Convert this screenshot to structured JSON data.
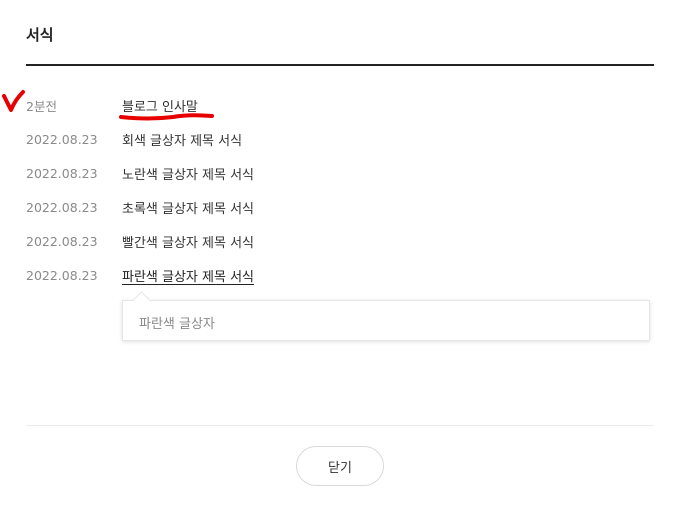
{
  "dialog": {
    "title": "서식"
  },
  "items": [
    {
      "date": "2분전",
      "title": "블로그 인사말"
    },
    {
      "date": "2022.08.23",
      "title": "회색 글상자 제목 서식"
    },
    {
      "date": "2022.08.23",
      "title": "노란색 글상자 제목 서식"
    },
    {
      "date": "2022.08.23",
      "title": "초록색 글상자 제목 서식"
    },
    {
      "date": "2022.08.23",
      "title": "빨간색 글상자 제목 서식"
    },
    {
      "date": "2022.08.23",
      "title": "파란색 글상자 제목 서식"
    }
  ],
  "tooltip": {
    "text": "파란색 글상자"
  },
  "footer": {
    "close_label": "닫기"
  },
  "annotation": {
    "color": "#e60000"
  }
}
